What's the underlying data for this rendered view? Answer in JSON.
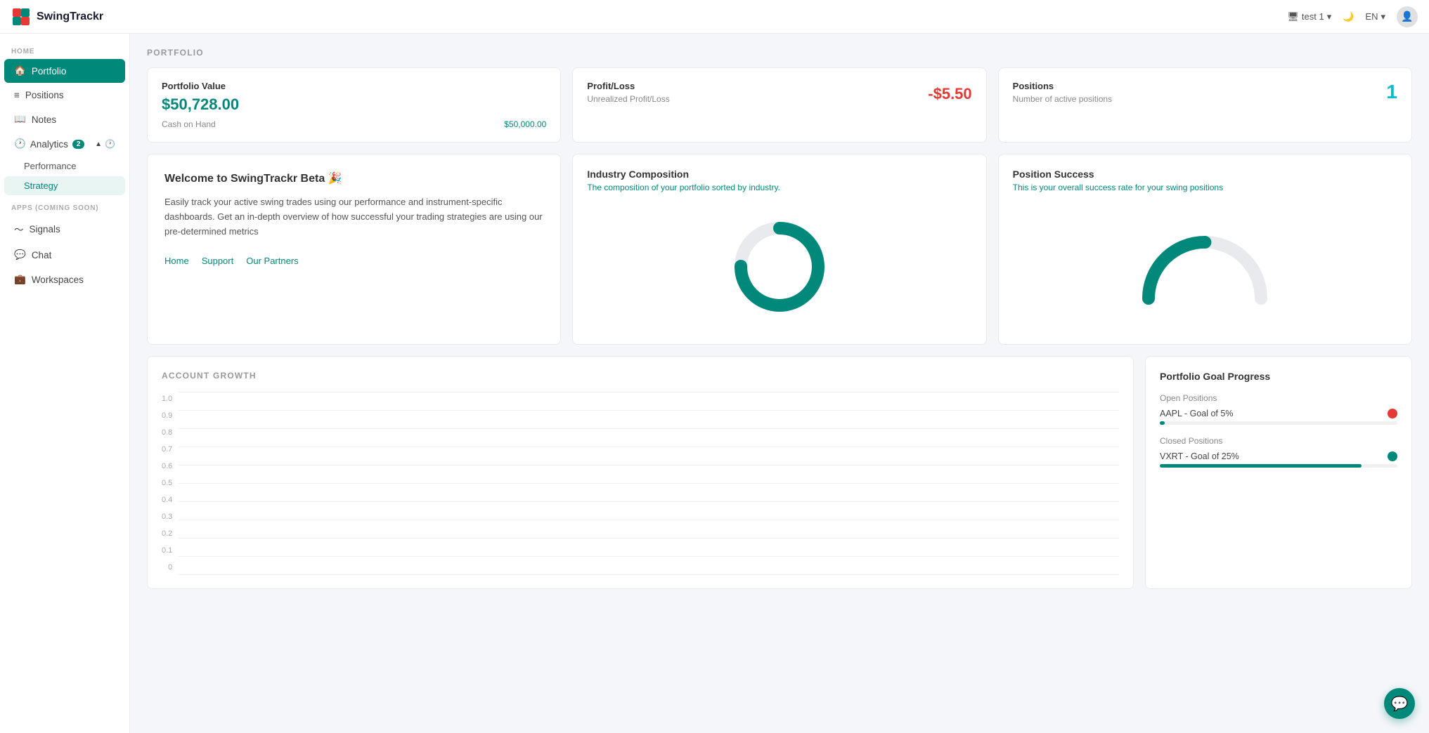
{
  "app": {
    "name": "SwingTrackr"
  },
  "header": {
    "user": "test 1",
    "language": "EN"
  },
  "sidebar": {
    "section_home": "HOME",
    "section_apps": "APPS (COMING SOON)",
    "items": [
      {
        "id": "portfolio",
        "label": "Portfolio",
        "active": true,
        "icon": "home"
      },
      {
        "id": "positions",
        "label": "Positions",
        "active": false,
        "icon": "list"
      },
      {
        "id": "notes",
        "label": "Notes",
        "active": false,
        "icon": "book"
      },
      {
        "id": "analytics",
        "label": "Analytics",
        "active": false,
        "icon": "clock",
        "badge": "2"
      },
      {
        "id": "signals",
        "label": "Signals",
        "active": false,
        "icon": "activity"
      },
      {
        "id": "chat",
        "label": "Chat",
        "active": false,
        "icon": "message"
      },
      {
        "id": "workspaces",
        "label": "Workspaces",
        "active": false,
        "icon": "briefcase"
      }
    ],
    "analytics_sub": [
      {
        "id": "performance",
        "label": "Performance"
      },
      {
        "id": "strategy",
        "label": "Strategy"
      }
    ]
  },
  "page": {
    "title": "PORTFOLIO",
    "portfolio_value": {
      "label": "Portfolio Value",
      "value": "$50,728.00",
      "cash_label": "Cash on Hand",
      "cash_value": "$50,000.00"
    },
    "profit_loss": {
      "label": "Profit/Loss",
      "value": "-$5.50",
      "sub_label": "Unrealized Profit/Loss"
    },
    "positions": {
      "label": "Positions",
      "value": "1",
      "sub_label": "Number of active positions"
    },
    "welcome": {
      "title": "Welcome to SwingTrackr Beta 🎉",
      "desc": "Easily track your active swing trades using our performance and instrument-specific dashboards. Get an in-depth overview of how successful your trading strategies are using our pre-determined metrics",
      "links": [
        "Home",
        "Support",
        "Our Partners"
      ]
    },
    "industry_composition": {
      "title": "Industry Composition",
      "subtitle": "The composition of your portfolio sorted by industry."
    },
    "position_success": {
      "title": "Position Success",
      "subtitle": "This is your overall success rate for your swing positions"
    },
    "account_growth": {
      "title": "ACCOUNT GROWTH",
      "y_labels": [
        "1.0",
        "0.9",
        "0.8",
        "0.7",
        "0.6",
        "0.5",
        "0.4",
        "0.3",
        "0.2",
        "0.1",
        "0"
      ]
    },
    "portfolio_goal": {
      "title": "Portfolio Goal Progress",
      "open_positions_label": "Open Positions",
      "aapl_goal": "AAPL - Goal of 5%",
      "closed_positions_label": "Closed Positions",
      "vxrt_goal": "VXRT - Goal of 25%",
      "vxrt_progress": 85
    }
  }
}
